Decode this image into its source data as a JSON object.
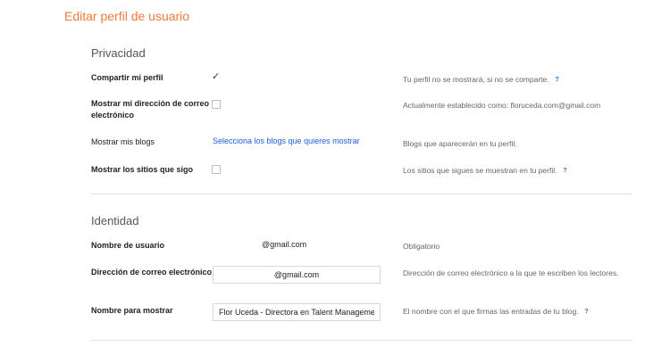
{
  "page_title": "Editar perfil de usuario",
  "privacy": {
    "title": "Privacidad",
    "share_profile": {
      "label": "Compartir mi perfil",
      "checked": true,
      "hint": "Tu perfil no se mostrará, si no se comparte.",
      "help": "?"
    },
    "show_email": {
      "label": "Mostrar mi dirección de correo electrónico",
      "checked": false,
      "hint": "Actualmente establecido como: floruceda.com@gmail.com"
    },
    "show_blogs": {
      "label": "Mostrar mis blogs",
      "link": "Selecciona los blogs que quieres mostrar",
      "hint": "Blogs que aparecerán en tu perfil."
    },
    "show_sites": {
      "label": "Mostrar los sitios que sigo",
      "checked": false,
      "hint": "Los sitios que sigues se muestran en tu perfil.",
      "help": "?"
    }
  },
  "identity": {
    "title": "Identidad",
    "username": {
      "label": "Nombre de usuario",
      "value": "@gmail.com",
      "hint": "Obligatorio"
    },
    "email": {
      "label": "Dirección de correo electrónico",
      "value": "@gmail.com",
      "hint": "Dirección de correo electrónico a la que te escriben los lectores."
    },
    "display_name": {
      "label": "Nombre para mostrar",
      "value": "Flor Uceda - Directora en Talent Managemer",
      "hint": "El nombre con el que firmas las entradas de tu blog.",
      "help": "?"
    }
  }
}
